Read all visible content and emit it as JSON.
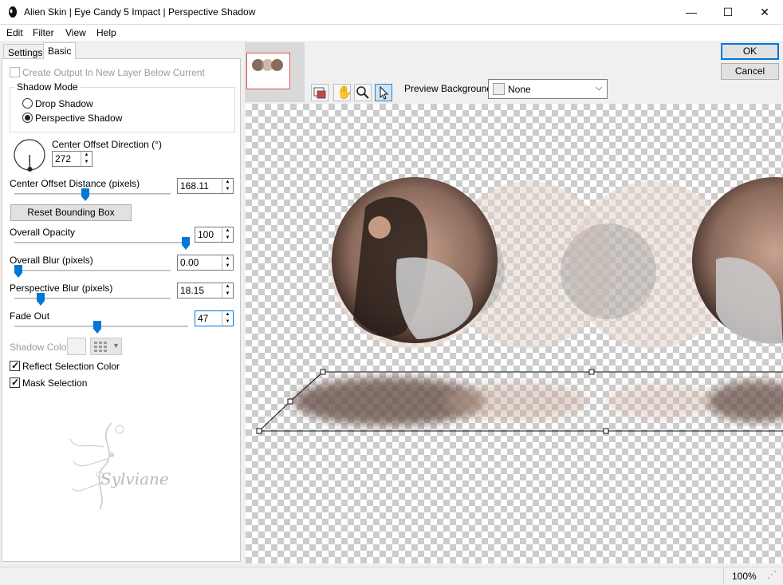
{
  "window": {
    "title": "Alien Skin | Eye Candy 5 Impact | Perspective Shadow",
    "minimize_glyph": "—",
    "maximize_glyph": "☐",
    "close_glyph": "✕"
  },
  "menu": [
    "Edit",
    "Filter",
    "View",
    "Help"
  ],
  "tabs": [
    {
      "label": "Settings",
      "active": false
    },
    {
      "label": "Basic",
      "active": true
    }
  ],
  "basic": {
    "create_output_label": "Create Output In New Layer Below Current",
    "create_output_checked": false,
    "shadow_mode_label": "Shadow Mode",
    "drop_shadow_label": "Drop Shadow",
    "perspective_shadow_label": "Perspective Shadow",
    "shadow_mode_selected": "Perspective Shadow",
    "center_offset_direction_label": "Center Offset Direction (°)",
    "center_offset_direction_value": "272",
    "center_offset_distance_label": "Center Offset Distance (pixels)",
    "center_offset_distance_value": "168.11",
    "reset_bounding_box_label": "Reset Bounding Box",
    "overall_opacity_label": "Overall Opacity",
    "overall_opacity_value": "100",
    "overall_blur_label": "Overall Blur (pixels)",
    "overall_blur_value": "0.00",
    "perspective_blur_label": "Perspective Blur (pixels)",
    "perspective_blur_value": "18.15",
    "fade_out_label": "Fade Out",
    "fade_out_value": "47",
    "shadow_color_label": "Shadow Color",
    "reflect_selection_color_label": "Reflect Selection Color",
    "reflect_selection_color_checked": true,
    "mask_selection_label": "Mask Selection",
    "mask_selection_checked": true
  },
  "watermark_text": "Sylviane",
  "buttons": {
    "ok": "OK",
    "cancel": "Cancel"
  },
  "preview": {
    "background_label": "Preview Background:",
    "background_value": "None",
    "tools": [
      "preview-bg-icon",
      "hand-icon",
      "zoom-icon",
      "pointer-icon"
    ]
  },
  "status": {
    "zoom": "100%"
  },
  "colors": {
    "accent": "#0078d7",
    "checker": "#cccccc",
    "selection_frame": "#e05050"
  }
}
